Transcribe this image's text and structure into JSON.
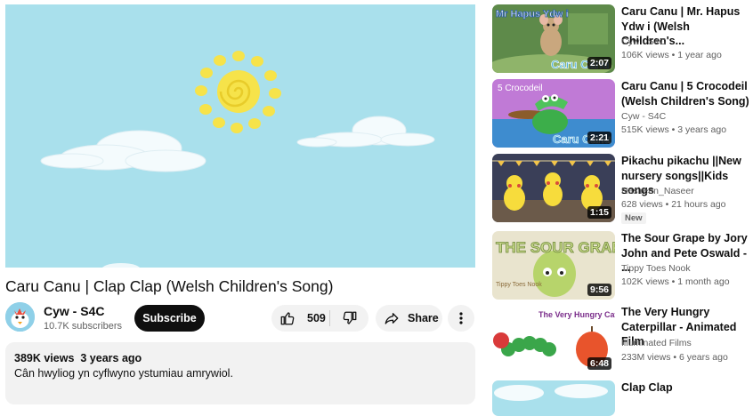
{
  "video": {
    "title": "Caru Canu | Clap Clap (Welsh Children's Song)",
    "channel": "Cyw - S4C",
    "subscribers": "10.7K subscribers",
    "subscribe_label": "Subscribe",
    "likes": "509",
    "share_label": "Share",
    "views": "389K views",
    "age": "3 years ago",
    "description": "Cân hwyliog yn cyflwyno ystumiau amrywiol."
  },
  "recommendations": [
    {
      "title": "Caru Canu | Mr. Hapus Ydw i (Welsh Children's...",
      "channel": "Cyw - S4C",
      "meta": "106K views  •  1 year ago",
      "duration": "2:07",
      "thumb_text": "Mr Hapus Ydw i",
      "thumb_logo": "Caru Canu"
    },
    {
      "title": "Caru Canu | 5 Crocodeil (Welsh Children's Song)",
      "channel": "Cyw - S4C",
      "meta": "515K views  •  3 years ago",
      "duration": "2:21",
      "thumb_text": "5 Crocodeil",
      "thumb_logo": "Caru Canu"
    },
    {
      "title": "Pikachu pikachu ||New nursery songs||Kids songs",
      "channel": "Nasireen_Naseer",
      "meta": "628 views  •  21 hours ago",
      "duration": "1:15",
      "badge": "New"
    },
    {
      "title": "The Sour Grape by Jory John and Pete Oswald - ...",
      "channel": "Tippy Toes Nook",
      "meta": "102K views  •  1 month ago",
      "duration": "9:56",
      "thumb_text": "THE SOUR GRAPE",
      "thumb_small": "Tippy Toes Nook"
    },
    {
      "title": "The Very Hungry Caterpillar - Animated Film",
      "channel": "Illuminated Films",
      "meta": "233M views  •  6 years ago",
      "duration": "6:48",
      "thumb_text": "The Very Hungry Caterpillar"
    },
    {
      "title": "Clap Clap"
    }
  ]
}
